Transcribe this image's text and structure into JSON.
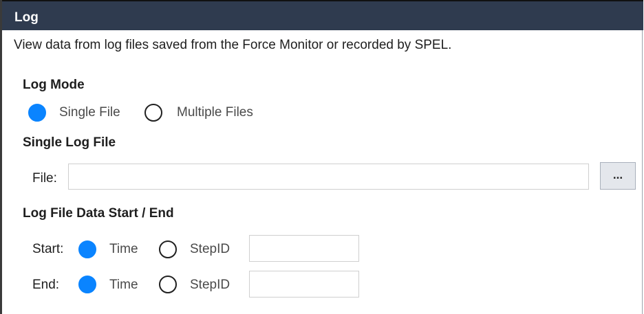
{
  "header": {
    "title": "Log"
  },
  "description": "View data from log files saved from the Force Monitor or recorded by SPEL.",
  "log_mode": {
    "title": "Log Mode",
    "options": [
      {
        "label": "Single File",
        "selected": true
      },
      {
        "label": "Multiple Files",
        "selected": false
      }
    ]
  },
  "single_log_file": {
    "title": "Single Log File",
    "file_label": "File:",
    "file_value": "",
    "browse_label": "..."
  },
  "data_range": {
    "title": "Log File Data Start / End",
    "start": {
      "label": "Start:",
      "options": [
        {
          "label": "Time",
          "selected": true
        },
        {
          "label": "StepID",
          "selected": false
        }
      ],
      "step_id_value": ""
    },
    "end": {
      "label": "End:",
      "options": [
        {
          "label": "Time",
          "selected": true
        },
        {
          "label": "StepID",
          "selected": false
        }
      ],
      "step_id_value": ""
    }
  },
  "colors": {
    "header_bg": "#2f3b4f",
    "radio_selected": "#0a84ff",
    "button_bg": "#e4e7ec"
  }
}
